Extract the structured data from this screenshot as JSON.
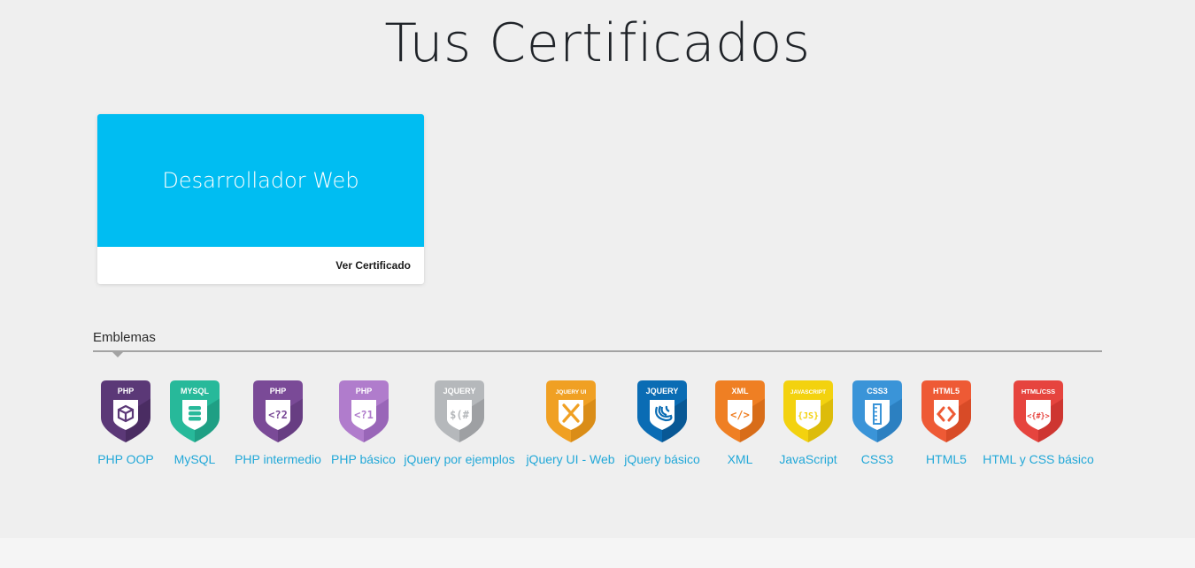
{
  "header": {
    "title": "Tus Certificados"
  },
  "certificate": {
    "title": "Desarrollador Web",
    "action_label": "Ver Certificado",
    "color": "#00bdf2"
  },
  "badges_section": {
    "label": "Emblemas",
    "items": [
      {
        "name": "PHP OOP",
        "tag": "PHP",
        "glyph": "",
        "icon": "cube-icon",
        "color": "#5b3877",
        "shade": "#3d2352"
      },
      {
        "name": "MySQL",
        "tag": "MYSQL",
        "glyph": "",
        "icon": "database-icon",
        "color": "#27b99a",
        "shade": "#1a8a72"
      },
      {
        "name": "PHP intermedio",
        "tag": "PHP",
        "glyph": "<?2",
        "icon": "php-intermediate-icon",
        "color": "#7a4a97",
        "shade": "#583371"
      },
      {
        "name": "PHP básico",
        "tag": "PHP",
        "glyph": "<?1",
        "icon": "php-basic-icon",
        "color": "#b07ccc",
        "shade": "#8754a8"
      },
      {
        "name": "jQuery por ejemplos",
        "tag": "JQUERY",
        "glyph": "$(#",
        "icon": "jquery-selector-icon",
        "color": "#b5b8bb",
        "shade": "#8a8d90"
      },
      {
        "name": "jQuery UI - Web",
        "tag": "JQUERY UI",
        "glyph": "",
        "icon": "tools-icon",
        "color": "#f0a023",
        "shade": "#c97e10"
      },
      {
        "name": "jQuery básico",
        "tag": "JQUERY",
        "glyph": "",
        "icon": "jquery-logo-icon",
        "color": "#0a6cb4",
        "shade": "#07487c"
      },
      {
        "name": "XML",
        "tag": "XML",
        "glyph": "</>",
        "icon": "code-tag-icon",
        "color": "#ef7f23",
        "shade": "#c45e12"
      },
      {
        "name": "JavaScript",
        "tag": "JAVASCRIPT",
        "glyph": "{JS}",
        "icon": "js-icon",
        "color": "#f3d20f",
        "shade": "#caa908"
      },
      {
        "name": "CSS3",
        "tag": "CSS3",
        "glyph": "",
        "icon": "ruler-icon",
        "color": "#3a94d8",
        "shade": "#2170ae"
      },
      {
        "name": "HTML5",
        "tag": "HTML5",
        "glyph": "<>",
        "icon": "html5-icon",
        "color": "#ee5a35",
        "shade": "#c73f1c"
      },
      {
        "name": "HTML y CSS básico",
        "tag": "HTML/CSS",
        "glyph": "<{#}>",
        "icon": "html-css-icon",
        "color": "#e6443e",
        "shade": "#b92c27"
      }
    ]
  }
}
